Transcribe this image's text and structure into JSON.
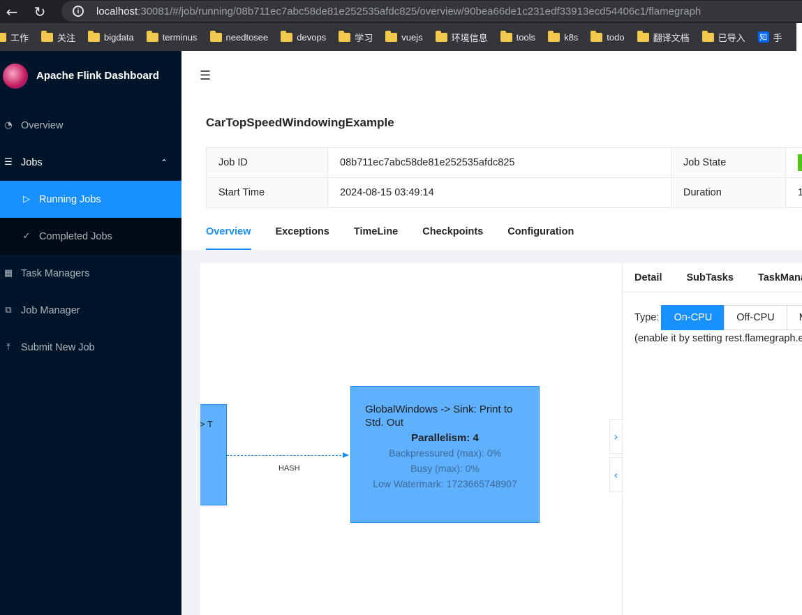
{
  "browser": {
    "url_host": "localhost",
    "url_rest": ":30081/#/job/running/08b711ec7abc58de81e252535afdc825/overview/90bea66de1c231edf33913ecd54406c1/flamegraph",
    "bookmarks": [
      "工作",
      "关注",
      "bigdata",
      "terminus",
      "needtosee",
      "devops",
      "学习",
      "vuejs",
      "环境信息",
      "tools",
      "k8s",
      "todo",
      "翻译文档",
      "已导入"
    ],
    "bookmark_last_icon": "知",
    "bookmark_last": "手"
  },
  "sidebar": {
    "title": "Apache Flink Dashboard",
    "items": [
      {
        "label": "Overview"
      },
      {
        "label": "Jobs"
      },
      {
        "label": "Running Jobs"
      },
      {
        "label": "Completed Jobs"
      },
      {
        "label": "Task Managers"
      },
      {
        "label": "Job Manager"
      },
      {
        "label": "Submit New Job"
      }
    ]
  },
  "job": {
    "name": "CarTopSpeedWindowingExample",
    "id_label": "Job ID",
    "id": "08b711ec7abc58de81e252535afdc825",
    "state_label": "Job State",
    "start_label": "Start Time",
    "start": "2024-08-15 03:49:14",
    "duration_label": "Duration",
    "duration": "1"
  },
  "tabs": [
    "Overview",
    "Exceptions",
    "TimeLine",
    "Checkpoints",
    "Configuration"
  ],
  "graph": {
    "left_node_text": "> T",
    "edge_label": "HASH",
    "main_node": {
      "name": "GlobalWindows -> Sink: Print to Std. Out",
      "parallelism": "Parallelism: 4",
      "backpressured": "Backpressured (max): 0%",
      "busy": "Busy (max): 0%",
      "watermark": "Low Watermark: 1723665748907"
    }
  },
  "detail_panel": {
    "tabs": [
      "Detail",
      "SubTasks",
      "TaskManagers"
    ],
    "type_label": "Type:",
    "types": [
      "On-CPU",
      "Off-CPU",
      "Mixed"
    ],
    "hint": "(enable it by setting rest.flamegraph.enabled: true)"
  },
  "colors": {
    "primary": "#1890ff",
    "sidebar_bg": "#001529",
    "node_fill": "#5fb0fd",
    "running_state": "#52c41a"
  }
}
